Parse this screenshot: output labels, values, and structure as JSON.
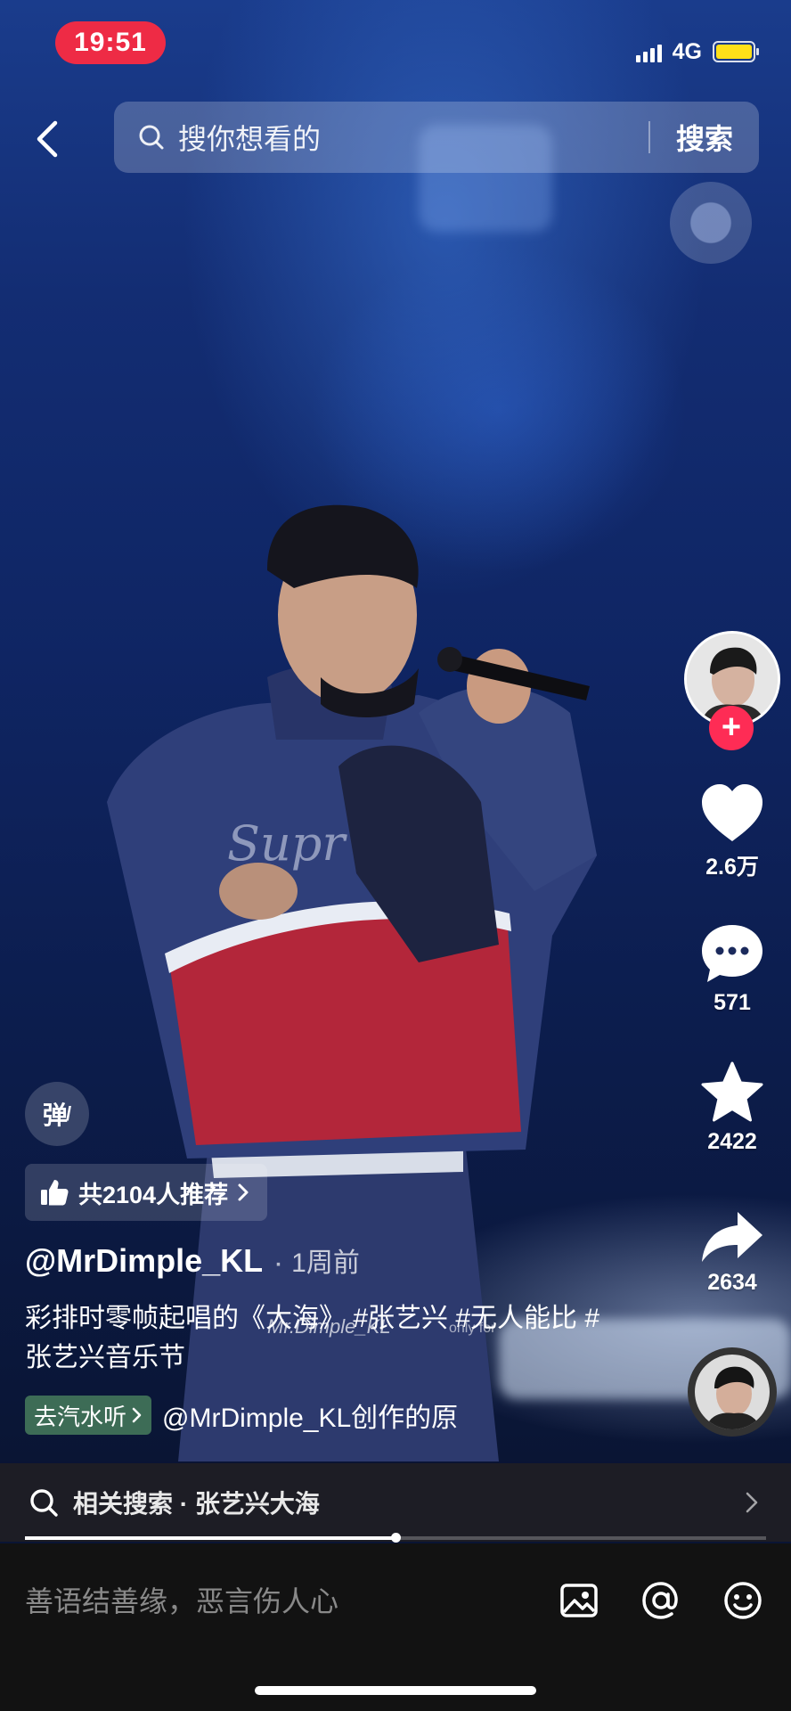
{
  "status_bar": {
    "time": "19:51",
    "network": "4G"
  },
  "search": {
    "placeholder": "搜你想看的",
    "button": "搜索"
  },
  "actions": {
    "likes": "2.6万",
    "comments": "571",
    "favorites": "2422",
    "shares": "2634"
  },
  "danmu_label": "弹",
  "recommend_label": "共2104人推荐",
  "post": {
    "author": "@MrDimple_KL",
    "time_ago": "1周前",
    "description": "彩排时零帧起唱的《大海》 #张艺兴 #无人能比 #张艺兴音乐节",
    "watermark": "Mr.Dimple_KL",
    "watermark_small": "only for"
  },
  "music": {
    "tag": "去汽水听",
    "text": "@MrDimple_KL创作的原"
  },
  "related_search": {
    "label": "相关搜索 · 张艺兴大海"
  },
  "progress": {
    "played_fraction": 0.5
  },
  "comment_input": {
    "placeholder": "善语结善缘，恶言伤人心"
  },
  "colors": {
    "accent": "#fe2c55",
    "status_time_bg": "#ee2b45",
    "battery": "#ffe018"
  }
}
